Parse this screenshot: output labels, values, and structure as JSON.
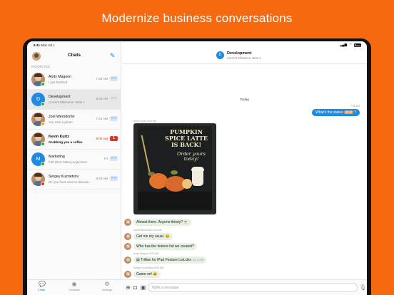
{
  "headline": "Modernize business conversations",
  "status": {
    "time": "9:41",
    "date": "Mon Jul 1"
  },
  "sidebar": {
    "title": "Chats",
    "section_label": "FAVORITES",
    "chats": [
      {
        "name": "Andy Magoon",
        "preview": "I just finished.",
        "time": "7:58 AM",
        "avatar": "photo",
        "status_color": "#2fae3d",
        "badge": "✓✓",
        "unread": false
      },
      {
        "name": "Development",
        "preview": "Current Milestone: Beta 1",
        "time": "8:08 AM",
        "avatar": "letter",
        "letter": "D",
        "status_color": "#2fae3d",
        "badge": "✓✓",
        "unread": false,
        "selected": true
      },
      {
        "name": "Joel Werndorfer",
        "preview": "You sent a photo",
        "time": "7:42 AM",
        "avatar": "photo",
        "status_color": "#f6a623",
        "badge": "✓✓",
        "unread": false
      },
      {
        "name": "Kevin Kurtz",
        "preview": "Grabbing you a coffee",
        "time": "8:02 AM",
        "avatar": "photo",
        "status_color": "#2fae3d",
        "badge": "1",
        "unread": true
      },
      {
        "name": "Marketing",
        "preview": "Fall 2019 Sales projections",
        "time": "Fri",
        "avatar": "letter",
        "letter": "M",
        "status_color": "#2fae3d",
        "badge": "✓✓",
        "unread": false
      },
      {
        "name": "Sergey Kuznetsov",
        "preview": "Do you have time to discuss...",
        "time": "8:06 AM",
        "avatar": "photo",
        "status_color": "#e0322a",
        "badge": "✓✓",
        "unread": false
      }
    ],
    "tabs": [
      {
        "label": "Chats",
        "icon": "chat-bubbles-icon"
      },
      {
        "label": "Contacts",
        "icon": "contact-icon"
      },
      {
        "label": "Settings",
        "icon": "gear-icon"
      }
    ]
  },
  "conversation": {
    "title": "Development",
    "subtitle": "Current Milestone: Beta 1",
    "avatar_letter": "D",
    "day_label": "Today",
    "outgoing": {
      "time": "7:58 AM",
      "text": "What's the status ",
      "mention": "@all",
      "trail": " ?"
    },
    "photo_sender": "Kevin Kurtz  8:02 AM",
    "photo_text": {
      "line1": "PUMPKIN SPICE LATTE IS BACK!",
      "line2": "Order yours today!"
    },
    "messages": [
      {
        "text": "Almost there. Anyone thirsty? ☕",
        "sender": ""
      },
      {
        "text": "Get me my usual. 😀",
        "sender": "Daniel Bausman  8:02 AM"
      },
      {
        "text": "Who has the feature list we created?",
        "sender": ""
      },
      {
        "text": "Trillian for iPad Feature List.xlsx",
        "size": "12.2 KB",
        "sender": "Andy Magoon  8:05 AM"
      },
      {
        "text": "Game on! 😀",
        "sender": "Sergey Kuznetsov  8:06 AM"
      }
    ],
    "input_placeholder": "Write a message"
  },
  "colors": {
    "brand_orange": "#f7690e",
    "accent_blue": "#1e8ae0",
    "incoming_bubble": "#e6f1e3"
  }
}
